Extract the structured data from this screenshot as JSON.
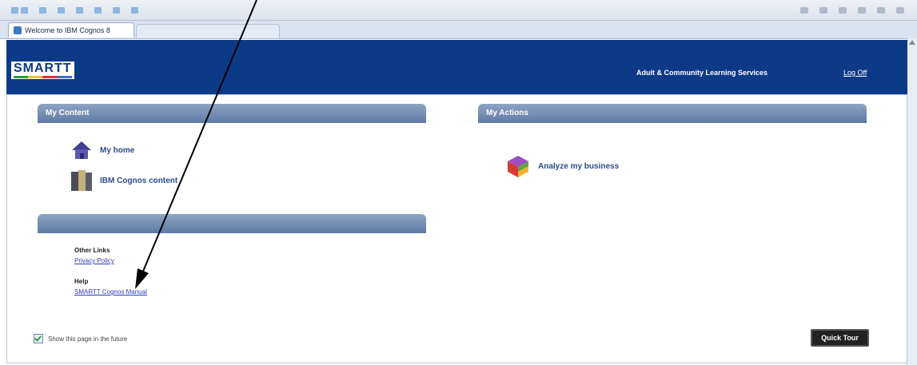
{
  "browser": {
    "tab_title": "Welcome to IBM Cognos 8"
  },
  "header": {
    "logo_text": "SMARTT",
    "organization": "Adult & Community Learning Services",
    "logoff_label": "Log Off"
  },
  "my_content": {
    "title": "My Content",
    "items": [
      {
        "label": "My home",
        "icon": "house-icon"
      },
      {
        "label": "IBM Cognos content",
        "icon": "books-icon"
      }
    ]
  },
  "links_panel": {
    "title": "",
    "other_links_label": "Other Links",
    "privacy_policy": "Privacy Policy",
    "help_label": "Help",
    "manual_link": "SMARTT Cognos Manual"
  },
  "my_actions": {
    "title": "My Actions",
    "items": [
      {
        "label": "Analyze my business",
        "icon": "cube-icon"
      }
    ]
  },
  "footer": {
    "show_page_label": "Show this page in the future",
    "show_page_checked": true,
    "quick_tour_label": "Quick Tour"
  },
  "colors": {
    "header_bg": "#0d3a87",
    "panel_header": "#6f89b0",
    "link": "#2a3fb8",
    "accent_text": "#2d4b8c"
  }
}
